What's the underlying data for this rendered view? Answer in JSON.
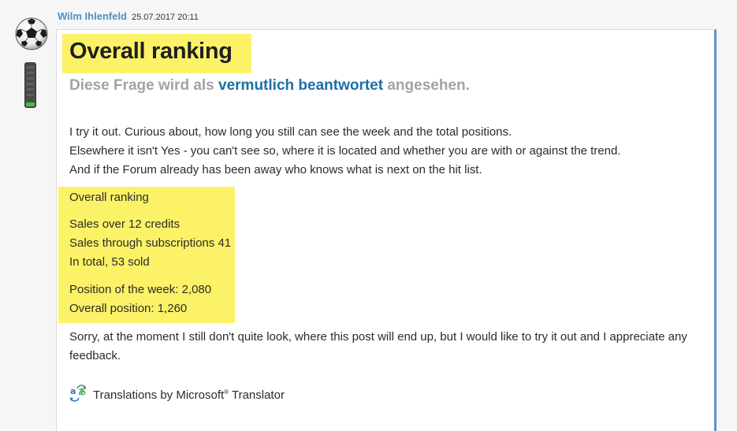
{
  "post": {
    "author": "Wilm Ihlenfeld",
    "timestamp": "25.07.2017 20:11",
    "title": "Overall ranking",
    "status_prefix": "Diese Frage wird als ",
    "status_link": "vermutlich beantwortet",
    "status_suffix": " angesehen.",
    "intro_lines": [
      "I try it out. Curious about, how long you still can see the week and the total positions.",
      "Elsewhere it isn't Yes - you can't see so, where it is located and whether you are with or against the trend.",
      "And if the Forum already has been away who knows what is next on the hit list."
    ],
    "ranking": {
      "heading": "Overall ranking",
      "sales_credits": "Sales over 12 credits",
      "sales_subscriptions": "Sales through subscriptions 41",
      "total_sold": "In total, 53 sold",
      "week_position": "Position of the week: 2,080",
      "overall_position": "Overall position: 1,260"
    },
    "closing": "Sorry, at the moment I still don't quite look, where this post will end up, but I would like to try it out and I appreciate any feedback.",
    "translator_prefix": "Translations by Microsoft",
    "translator_reg": "®",
    "translator_suffix": " Translator"
  },
  "user_rank": {
    "level_fraction": 0.1
  },
  "colors": {
    "highlight": "#fcf267",
    "author": "#4a90c8",
    "status_link": "#1e6fa5",
    "status_text": "#a3a3a3",
    "rank_fill": "#3ec43a",
    "post_border_accent": "#5b95c8"
  },
  "icons": {
    "avatar": "soccer-ball-icon",
    "rank": "rank-meter-icon",
    "translator": "microsoft-translator-icon"
  }
}
